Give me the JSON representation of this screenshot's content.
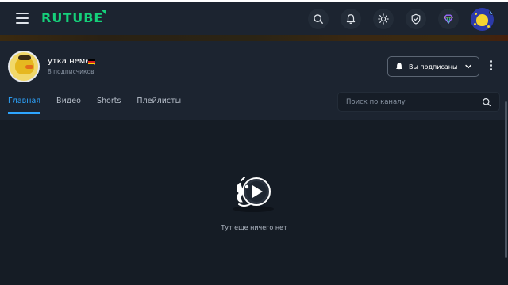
{
  "header": {
    "logo_text": "RUTUBE",
    "icons": [
      "menu-icon",
      "search-icon",
      "bell-icon",
      "theme-sun-icon",
      "shield-icon",
      "diamond-icon",
      "avatar"
    ],
    "accent_color": "#15d07a"
  },
  "channel": {
    "name": "утка немец",
    "subscribers": "8 подписчиков",
    "subscribe_label": "Вы подписаны"
  },
  "tabs": [
    {
      "label": "Главная",
      "active": true
    },
    {
      "label": "Видео",
      "active": false
    },
    {
      "label": "Shorts",
      "active": false
    },
    {
      "label": "Плейлисты",
      "active": false
    }
  ],
  "search": {
    "placeholder": "Поиск по каналу"
  },
  "empty_state": {
    "text": "Тут еще ничего нет"
  }
}
